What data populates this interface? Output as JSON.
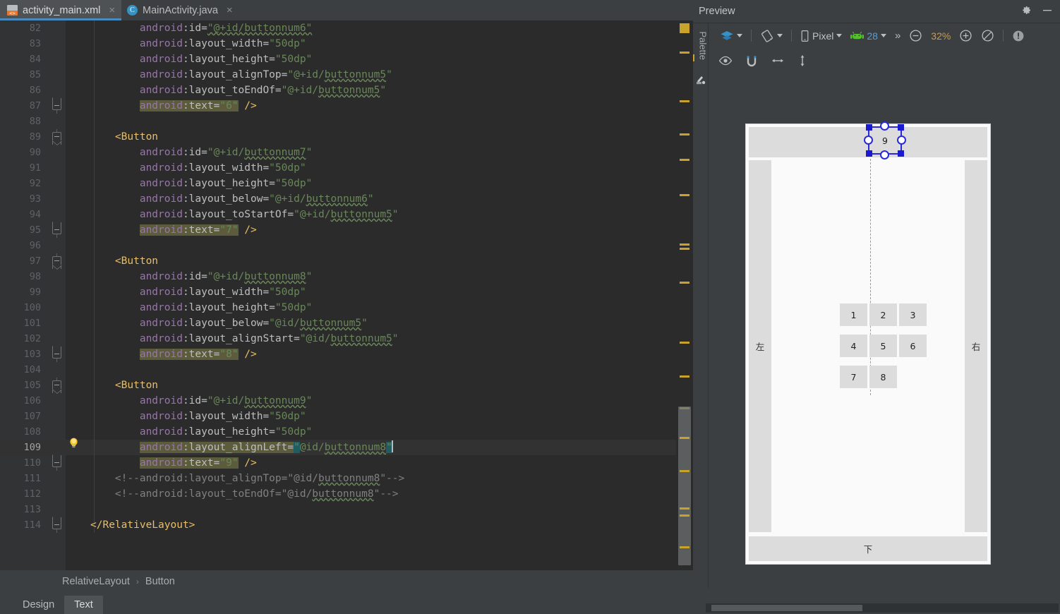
{
  "editor": {
    "tabs": [
      {
        "label": "activity_main.xml",
        "icon": "xml-file-icon",
        "active": true,
        "close": "×"
      },
      {
        "label": "MainActivity.java",
        "icon": "java-class-icon",
        "active": false,
        "close": "×"
      }
    ],
    "breadcrumb": {
      "parent": "RelativeLayout",
      "separator": "›",
      "child": "Button"
    },
    "bottom_tabs": [
      {
        "label": "Design",
        "active": false
      },
      {
        "label": "Text",
        "active": true
      }
    ],
    "lines": [
      {
        "n": "82",
        "html": "        <span class='s-attr'>android</span><span class='s-attr2'>:id=</span><span class='s-val squig'>\"@+id/buttonnum6\"</span>"
      },
      {
        "n": "83",
        "html": "        <span class='s-attr'>android</span><span class='s-attr2'>:layout_width=</span><span class='s-val'>\"50dp\"</span>"
      },
      {
        "n": "84",
        "html": "        <span class='s-attr'>android</span><span class='s-attr2'>:layout_height=</span><span class='s-val'>\"50dp\"</span>"
      },
      {
        "n": "85",
        "html": "        <span class='s-attr'>android</span><span class='s-attr2'>:layout_alignTop=</span><span class='s-val'>\"@+id/</span><span class='s-val squig'>buttonnum5</span><span class='s-val'>\"</span>"
      },
      {
        "n": "86",
        "html": "        <span class='s-attr'>android</span><span class='s-attr2'>:layout_toEndOf=</span><span class='s-val'>\"@+id/</span><span class='s-val squig'>buttonnum5</span><span class='s-val'>\"</span>"
      },
      {
        "n": "87",
        "html": "        <span class='hl'><span class='s-attr'>android</span><span class='s-attr2'>:text=</span><span class='s-val'>\"6\"</span></span> <span class='s-br'>/&gt;</span>"
      },
      {
        "n": "88",
        "html": ""
      },
      {
        "n": "89",
        "html": "    <span class='s-tag'>&lt;Button</span>"
      },
      {
        "n": "90",
        "html": "        <span class='s-attr'>android</span><span class='s-attr2'>:id=</span><span class='s-val'>\"@+id/</span><span class='s-val squig'>buttonnum7</span><span class='s-val'>\"</span>"
      },
      {
        "n": "91",
        "html": "        <span class='s-attr'>android</span><span class='s-attr2'>:layout_width=</span><span class='s-val'>\"50dp\"</span>"
      },
      {
        "n": "92",
        "html": "        <span class='s-attr'>android</span><span class='s-attr2'>:layout_height=</span><span class='s-val'>\"50dp\"</span>"
      },
      {
        "n": "93",
        "html": "        <span class='s-attr'>android</span><span class='s-attr2'>:layout_below=</span><span class='s-val'>\"@+id/</span><span class='s-val squig'>buttonnum6</span><span class='s-val'>\"</span>"
      },
      {
        "n": "94",
        "html": "        <span class='s-attr'>android</span><span class='s-attr2'>:layout_toStartOf=</span><span class='s-val'>\"@+id/</span><span class='s-val squig'>buttonnum5</span><span class='s-val'>\"</span>"
      },
      {
        "n": "95",
        "html": "        <span class='hl'><span class='s-attr'>android</span><span class='s-attr2'>:text=</span><span class='s-val'>\"7\"</span></span> <span class='s-br'>/&gt;</span>"
      },
      {
        "n": "96",
        "html": ""
      },
      {
        "n": "97",
        "html": "    <span class='s-tag'>&lt;Button</span>"
      },
      {
        "n": "98",
        "html": "        <span class='s-attr'>android</span><span class='s-attr2'>:id=</span><span class='s-val'>\"@+id/</span><span class='s-val squig'>buttonnum8</span><span class='s-val'>\"</span>"
      },
      {
        "n": "99",
        "html": "        <span class='s-attr'>android</span><span class='s-attr2'>:layout_width=</span><span class='s-val'>\"50dp\"</span>"
      },
      {
        "n": "100",
        "html": "        <span class='s-attr'>android</span><span class='s-attr2'>:layout_height=</span><span class='s-val'>\"50dp\"</span>"
      },
      {
        "n": "101",
        "html": "        <span class='s-attr'>android</span><span class='s-attr2'>:layout_below=</span><span class='s-val'>\"@id/</span><span class='s-val squig'>buttonnum5</span><span class='s-val'>\"</span>"
      },
      {
        "n": "102",
        "html": "        <span class='s-attr'>android</span><span class='s-attr2'>:layout_alignStart=</span><span class='s-val'>\"@id/</span><span class='s-val squig'>buttonnum5</span><span class='s-val'>\"</span>"
      },
      {
        "n": "103",
        "html": "        <span class='hl'><span class='s-attr'>android</span><span class='s-attr2'>:text=</span><span class='s-val'>\"8\"</span></span> <span class='s-br'>/&gt;</span>"
      },
      {
        "n": "104",
        "html": ""
      },
      {
        "n": "105",
        "html": "    <span class='s-tag'>&lt;Button</span>"
      },
      {
        "n": "106",
        "html": "        <span class='s-attr'>android</span><span class='s-attr2'>:id=</span><span class='s-val'>\"@+id/</span><span class='s-val squig'>buttonnum9</span><span class='s-val'>\"</span>"
      },
      {
        "n": "107",
        "html": "        <span class='s-attr'>android</span><span class='s-attr2'>:layout_width=</span><span class='s-val'>\"50dp\"</span>"
      },
      {
        "n": "108",
        "html": "        <span class='s-attr'>android</span><span class='s-attr2'>:layout_height=</span><span class='s-val'>\"50dp\"</span>"
      },
      {
        "n": "109",
        "html": "        <span class='hl'><span class='s-attr'>android</span><span class='s-attr2'>:layout_alignLeft=</span></span><span class='sel-q s-val'>\"</span><span class='s-val'>@id/</span><span class='s-val squig'>buttonnum8</span><span class='sel-q s-val'>\"</span><span class='caret'></span>",
        "current": true
      },
      {
        "n": "110",
        "html": "        <span class='hl'><span class='s-attr'>android</span><span class='s-attr2'>:text=</span><span class='s-val'>\"9\"</span></span> <span class='s-br'>/&gt;</span>"
      },
      {
        "n": "111",
        "html": "    <span class='s-cmt'>&lt;!--android:layout_alignTop=\"@id/</span><span class='s-cmt squig'>buttonnum8</span><span class='s-cmt'>\"--&gt;</span>"
      },
      {
        "n": "112",
        "html": "    <span class='s-cmt'>&lt;!--android:layout_toEndOf=\"@id/</span><span class='s-cmt squig'>buttonnum8</span><span class='s-cmt'>\"--&gt;</span>"
      },
      {
        "n": "113",
        "html": ""
      },
      {
        "n": "114",
        "html": "<span class='s-tag'>&lt;/RelativeLayout&gt;</span>"
      }
    ]
  },
  "preview": {
    "title": "Preview",
    "gear_icon": "gear-icon",
    "minimize_icon": "minimize-icon",
    "palette_label": "Palette",
    "toolbar": {
      "design_surface_icon": "layers-icon",
      "orientation_icon": "rotate-device-icon",
      "device_icon": "phone-icon",
      "device_label": "Pixel",
      "api_icon": "android-robot-icon",
      "api_label": "28",
      "overflow_label": "»",
      "zoom_out_icon": "zoom-out-icon",
      "zoom_level": "32%",
      "zoom_in_icon": "zoom-in-icon",
      "zoom_fit_icon": "zoom-fit-icon",
      "issues_icon": "warning-info-icon"
    },
    "toolbar2": {
      "show_icon": "eye-icon",
      "magnet_icon": "magnet-icon",
      "h_arrow_icon": "horizontal-arrow-icon",
      "v_arrow_icon": "vertical-arrow-icon"
    },
    "device_screen": {
      "left_label": "左",
      "right_label": "右",
      "bottom_label": "下",
      "selected_label": "9",
      "buttons": [
        "1",
        "2",
        "3",
        "4",
        "5",
        "6",
        "7",
        "8"
      ]
    }
  },
  "colors": {
    "accent_blue": "#4a8bbf",
    "selection_handle": "#2a2ad8",
    "warning_marker": "#c9a22c",
    "string_green": "#6a8759",
    "attr_purple": "#9876aa",
    "tag_orange": "#e8bf6a",
    "highlight_olive": "#5c5c3d"
  }
}
